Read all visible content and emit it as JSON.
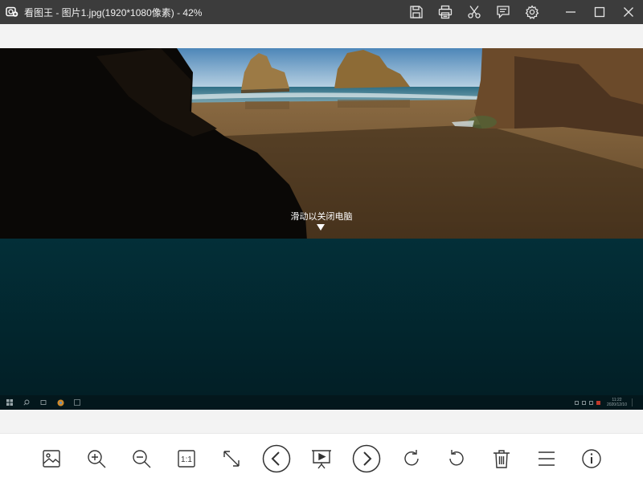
{
  "window": {
    "title": "看图王 - 图片1.jpg(1920*1080像素) - 42%",
    "app_logo_icon": "photo-viewer-logo-icon",
    "title_tools": [
      "save-icon",
      "print-icon",
      "cut-icon",
      "feedback-icon",
      "settings-icon"
    ],
    "window_controls": [
      "minimize-icon",
      "maximize-icon",
      "close-icon"
    ]
  },
  "image": {
    "lock_hint": "滑动以关闭电脑",
    "taskbar_clock": {
      "time": "11:22",
      "date": "2020/12/10"
    }
  },
  "toolbar": {
    "tools": [
      "image-open-icon",
      "zoom-in-icon",
      "zoom-out-icon",
      "actual-size-icon",
      "fit-window-icon",
      "previous-icon",
      "slideshow-icon",
      "next-icon",
      "rotate-clockwise-icon",
      "rotate-counterclockwise-icon",
      "delete-icon",
      "menu-icon",
      "info-icon"
    ],
    "actual_size_label": "1:1"
  },
  "colors": {
    "titlebar": "#3c3c3c",
    "viewer_bg": "#f3f3f3",
    "toolbar_bg": "#ffffff",
    "icon": "#333333",
    "lockscreen_teal": "#032f38"
  }
}
